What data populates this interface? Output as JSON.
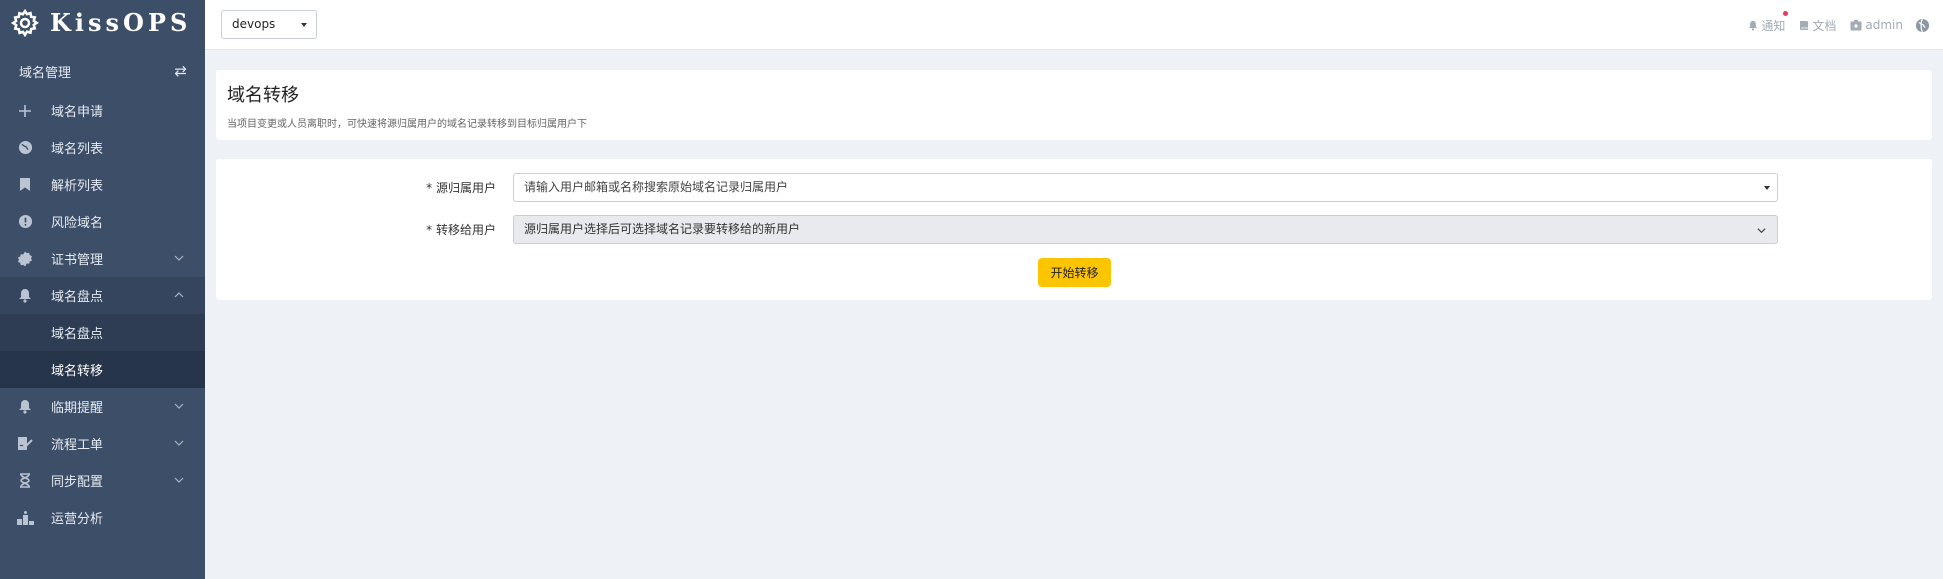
{
  "app": {
    "name": "KissOPS"
  },
  "sidebar": {
    "group_title": "域名管理",
    "items": [
      {
        "label": "域名申请"
      },
      {
        "label": "域名列表"
      },
      {
        "label": "解析列表"
      },
      {
        "label": "风险域名"
      },
      {
        "label": "证书管理"
      },
      {
        "label": "域名盘点",
        "children": [
          {
            "label": "域名盘点"
          },
          {
            "label": "域名转移",
            "active": true
          }
        ]
      },
      {
        "label": "临期提醒"
      },
      {
        "label": "流程工单"
      },
      {
        "label": "同步配置"
      },
      {
        "label": "运营分析"
      }
    ]
  },
  "topbar": {
    "env_value": "devops",
    "notify_label": "通知",
    "docs_label": "文档",
    "user_label": "admin"
  },
  "page": {
    "title": "域名转移",
    "description": "当项目变更或人员离职时，可快速将源归属用户的域名记录转移到目标归属用户下"
  },
  "form": {
    "source_label": "* 源归属用户",
    "source_placeholder": "请输入用户邮箱或名称搜索原始域名记录归属用户",
    "target_label": "* 转移给用户",
    "target_placeholder": "源归属用户选择后可选择域名记录要转移给的新用户",
    "submit_label": "开始转移"
  },
  "colors": {
    "sidebar_bg": "#3d4e68",
    "accent_button": "#fdc400",
    "notify_dot": "#f0375e"
  }
}
